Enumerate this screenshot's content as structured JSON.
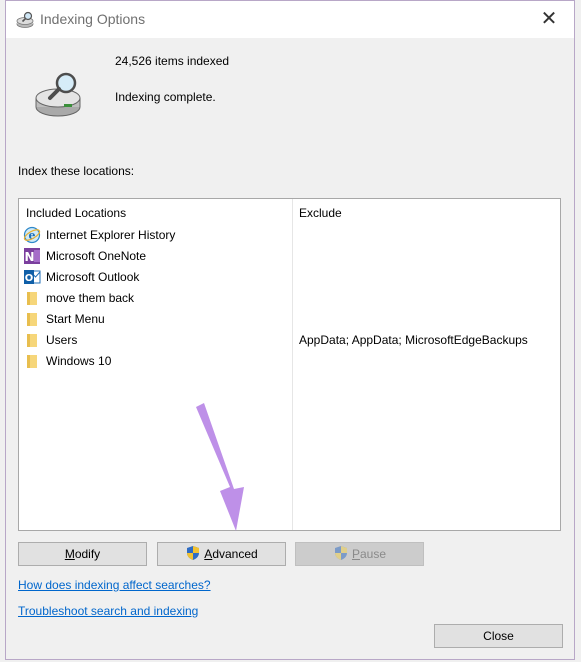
{
  "window": {
    "title": "Indexing Options"
  },
  "status": {
    "items_indexed": "24,526 items indexed",
    "state": "Indexing complete."
  },
  "locations": {
    "label": "Index these locations:",
    "col_included": "Included Locations",
    "col_exclude": "Exclude",
    "items": [
      {
        "label": "Internet Explorer History",
        "icon": "internet-explorer-icon",
        "exclude": ""
      },
      {
        "label": "Microsoft OneNote",
        "icon": "onenote-icon",
        "exclude": ""
      },
      {
        "label": "Microsoft Outlook",
        "icon": "outlook-icon",
        "exclude": ""
      },
      {
        "label": "move them back",
        "icon": "folder-icon",
        "exclude": ""
      },
      {
        "label": "Start Menu",
        "icon": "folder-icon",
        "exclude": ""
      },
      {
        "label": "Users",
        "icon": "folder-icon",
        "exclude": "AppData; AppData; MicrosoftEdgeBackups"
      },
      {
        "label": "Windows 10",
        "icon": "folder-icon",
        "exclude": ""
      }
    ]
  },
  "buttons": {
    "modify_first": "M",
    "modify_rest": "odify",
    "advanced_first": "A",
    "advanced_rest": "dvanced",
    "pause_first": "P",
    "pause_rest": "ause",
    "close": "Close"
  },
  "links": {
    "help": "How does indexing affect searches?",
    "troubleshoot": "Troubleshoot search and indexing"
  },
  "colors": {
    "link": "#0066cc",
    "annotation_arrow": "#b784e6"
  }
}
